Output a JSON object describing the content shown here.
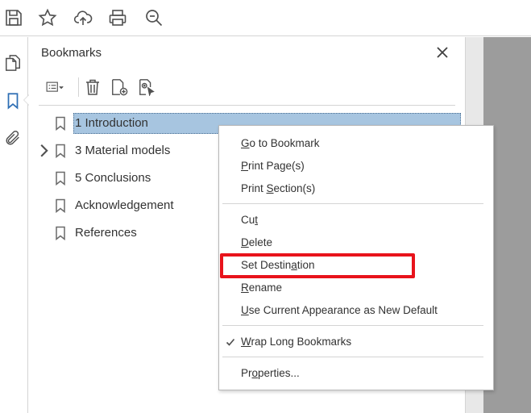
{
  "toolbar": {
    "icons": [
      "save-icon",
      "star-icon",
      "cloud-upload-icon",
      "print-icon",
      "zoom-search-icon"
    ]
  },
  "left_rail": {
    "icons": [
      "pages-icon",
      "bookmark-icon",
      "attachment-icon"
    ],
    "active": "bookmark-icon"
  },
  "panel": {
    "title": "Bookmarks",
    "tools": [
      "options-icon",
      "delete-icon",
      "new-bookmark-icon",
      "new-bookmark-from-structure-icon"
    ]
  },
  "bookmarks": [
    {
      "label": "1 Introduction",
      "selected": true,
      "expandable": false
    },
    {
      "label": "3 Material models",
      "selected": false,
      "expandable": true
    },
    {
      "label": "5 Conclusions",
      "selected": false,
      "expandable": false
    },
    {
      "label": "Acknowledgement",
      "selected": false,
      "expandable": false
    },
    {
      "label": "References",
      "selected": false,
      "expandable": false
    }
  ],
  "context_menu": {
    "items": [
      {
        "pre": "",
        "key": "G",
        "post": "o to Bookmark"
      },
      {
        "pre": "",
        "key": "P",
        "post": "rint Page(s)"
      },
      {
        "pre": "Print ",
        "key": "S",
        "post": "ection(s)"
      },
      {
        "pre": "Cu",
        "key": "t",
        "post": ""
      },
      {
        "pre": "",
        "key": "D",
        "post": "elete"
      },
      {
        "pre": "Set Destin",
        "key": "a",
        "post": "tion"
      },
      {
        "pre": "",
        "key": "R",
        "post": "ename"
      },
      {
        "pre": "",
        "key": "U",
        "post": "se Current Appearance as New Default"
      },
      {
        "pre": "",
        "key": "W",
        "post": "rap Long Bookmarks",
        "checked": true
      },
      {
        "pre": "Pr",
        "key": "o",
        "post": "perties..."
      }
    ],
    "highlighted": "Set Destination"
  },
  "colors": {
    "selection": "#a7c5e0",
    "highlight_outline": "#e8131b",
    "active_icon": "#2d6eb4"
  }
}
